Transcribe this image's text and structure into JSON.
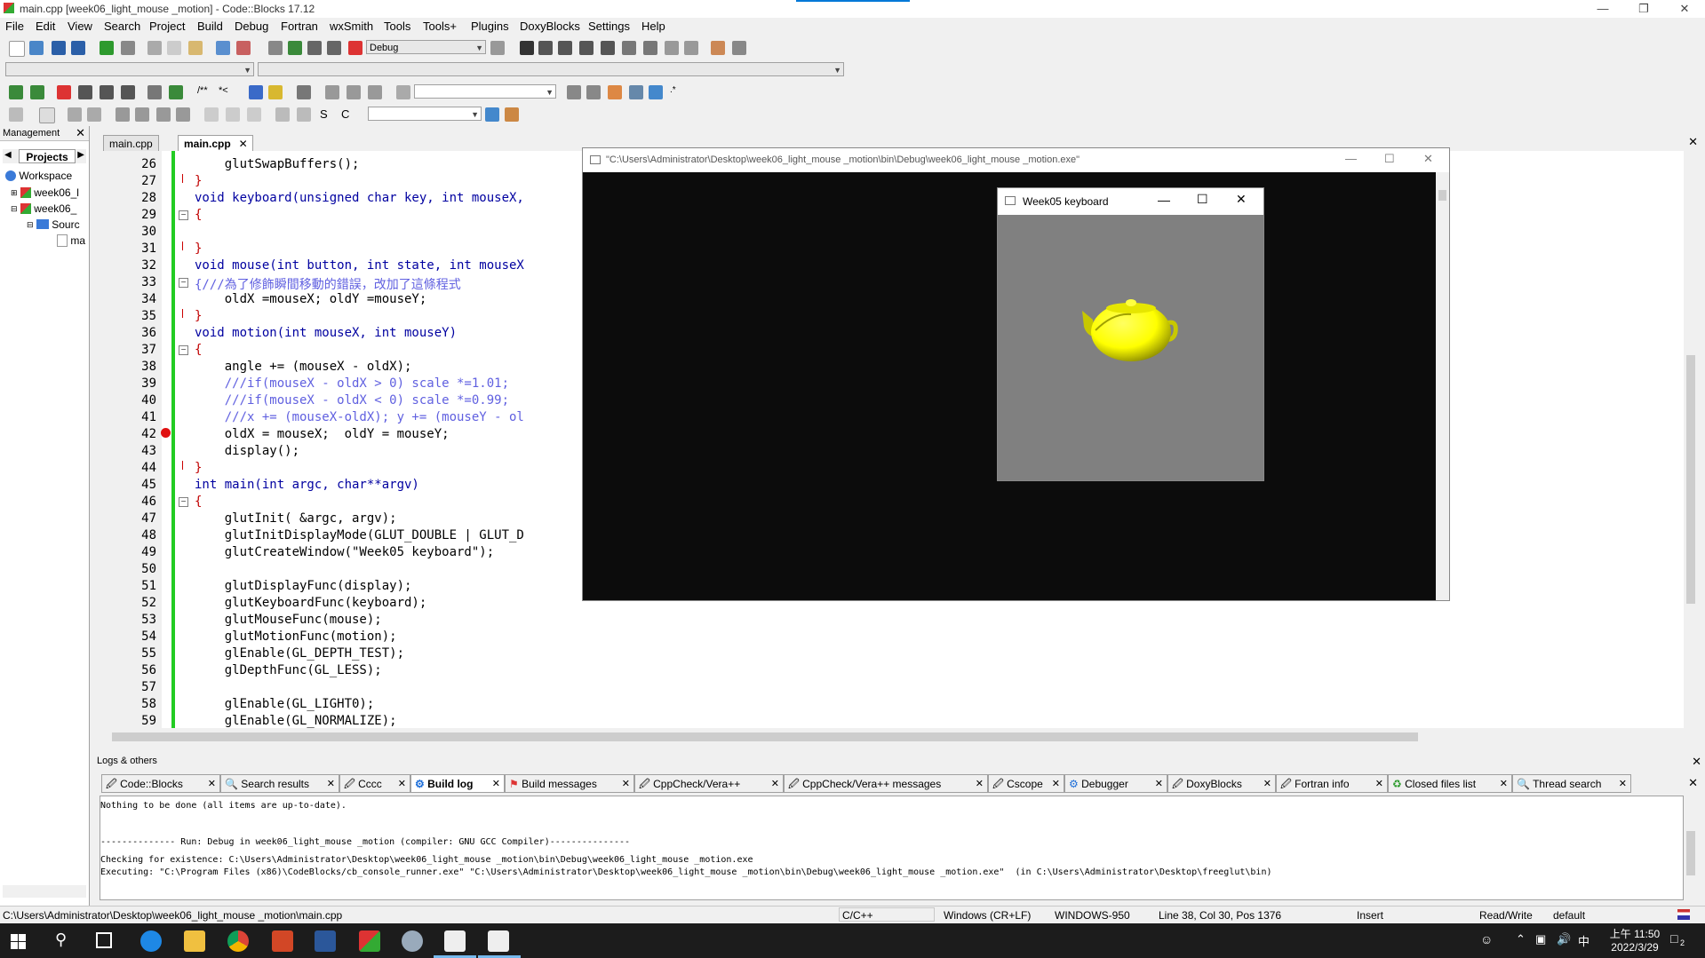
{
  "window": {
    "title": "main.cpp [week06_light_mouse _motion] - Code::Blocks 17.12"
  },
  "menu": [
    "File",
    "Edit",
    "View",
    "Search",
    "Project",
    "Build",
    "Debug",
    "Fortran",
    "wxSmith",
    "Tools",
    "Tools+",
    "Plugins",
    "DoxyBlocks",
    "Settings",
    "Help"
  ],
  "toolbar": {
    "build_target": "Debug"
  },
  "management": {
    "title": "Management",
    "tab": "Projects",
    "tree": [
      "Workspace",
      "week06_l",
      "week06_",
      "Sourc",
      "ma"
    ]
  },
  "editor": {
    "tabs": [
      "main.cpp",
      "main.cpp"
    ],
    "active_tab": "main.cpp",
    "lines": [
      {
        "n": "26",
        "html": "    glutSwapBuffers();"
      },
      {
        "n": "27",
        "html": "}"
      },
      {
        "n": "28",
        "html": "void keyboard(unsigned char key, int mouseX,"
      },
      {
        "n": "29",
        "html": "{"
      },
      {
        "n": "30",
        "html": ""
      },
      {
        "n": "31",
        "html": "}"
      },
      {
        "n": "32",
        "html": "void mouse(int button, int state, int mouseX"
      },
      {
        "n": "33",
        "html": "{///為了修飾瞬間移動的錯誤，改加了這條程式"
      },
      {
        "n": "34",
        "html": "    oldX =mouseX; oldY =mouseY;"
      },
      {
        "n": "35",
        "html": "}"
      },
      {
        "n": "36",
        "html": "void motion(int mouseX, int mouseY)"
      },
      {
        "n": "37",
        "html": "{"
      },
      {
        "n": "38",
        "html": "    angle += (mouseX - oldX);"
      },
      {
        "n": "39",
        "html": "    ///if(mouseX - oldX > 0) scale *=1.01;"
      },
      {
        "n": "40",
        "html": "    ///if(mouseX - oldX < 0) scale *=0.99;"
      },
      {
        "n": "41",
        "html": "    ///x += (mouseX-oldX); y += (mouseY - ol"
      },
      {
        "n": "42",
        "html": "    oldX = mouseX;  oldY = mouseY;"
      },
      {
        "n": "43",
        "html": "    display();"
      },
      {
        "n": "44",
        "html": "}"
      },
      {
        "n": "45",
        "html": "int main(int argc, char**argv)"
      },
      {
        "n": "46",
        "html": "{"
      },
      {
        "n": "47",
        "html": "    glutInit( &argc, argv);"
      },
      {
        "n": "48",
        "html": "    glutInitDisplayMode(GLUT_DOUBLE | GLUT_D"
      },
      {
        "n": "49",
        "html": "    glutCreateWindow(\"Week05 keyboard\");"
      },
      {
        "n": "50",
        "html": ""
      },
      {
        "n": "51",
        "html": "    glutDisplayFunc(display);"
      },
      {
        "n": "52",
        "html": "    glutKeyboardFunc(keyboard);"
      },
      {
        "n": "53",
        "html": "    glutMouseFunc(mouse);"
      },
      {
        "n": "54",
        "html": "    glutMotionFunc(motion);"
      },
      {
        "n": "55",
        "html": "    glEnable(GL_DEPTH_TEST);"
      },
      {
        "n": "56",
        "html": "    glDepthFunc(GL_LESS);"
      },
      {
        "n": "57",
        "html": ""
      },
      {
        "n": "58",
        "html": "    glEnable(GL_LIGHT0);"
      },
      {
        "n": "59",
        "html": "    glEnable(GL_NORMALIZE);"
      }
    ]
  },
  "console_window": {
    "title": "\"C:\\Users\\Administrator\\Desktop\\week06_light_mouse _motion\\bin\\Debug\\week06_light_mouse _motion.exe\""
  },
  "glut_window": {
    "title": "Week05 keyboard"
  },
  "logs": {
    "title": "Logs & others",
    "tabs": [
      "Code::Blocks",
      "Search results",
      "Cccc",
      "Build log",
      "Build messages",
      "CppCheck/Vera++",
      "CppCheck/Vera++ messages",
      "Cscope",
      "Debugger",
      "DoxyBlocks",
      "Fortran info",
      "Closed files list",
      "Thread search"
    ],
    "active_tab": "Build log",
    "lines": [
      "Nothing to be done (all items are up-to-date).",
      "",
      "",
      "-------------- Run: Debug in week06_light_mouse _motion (compiler: GNU GCC Compiler)---------------",
      "Checking for existence: C:\\Users\\Administrator\\Desktop\\week06_light_mouse _motion\\bin\\Debug\\week06_light_mouse _motion.exe",
      "Executing: \"C:\\Program Files (x86)\\CodeBlocks/cb_console_runner.exe\" \"C:\\Users\\Administrator\\Desktop\\week06_light_mouse _motion\\bin\\Debug\\week06_light_mouse _motion.exe\"  (in C:\\Users\\Administrator\\Desktop\\freeglut\\bin)"
    ]
  },
  "status": {
    "path": "C:\\Users\\Administrator\\Desktop\\week06_light_mouse _motion\\main.cpp",
    "lang": "C/C++",
    "eol": "Windows (CR+LF)",
    "encoding": "WINDOWS-950",
    "position": "Line 38, Col 30, Pos 1376",
    "mode": "Insert",
    "access": "Read/Write",
    "style": "default"
  },
  "taskbar": {
    "time": "上午 11:50",
    "date": "2022/3/29",
    "ime": "中",
    "notifications": "2"
  },
  "colors": {
    "accent": "#0078d7",
    "change_bar": "#22cc22",
    "teapot": "#ffff00"
  }
}
